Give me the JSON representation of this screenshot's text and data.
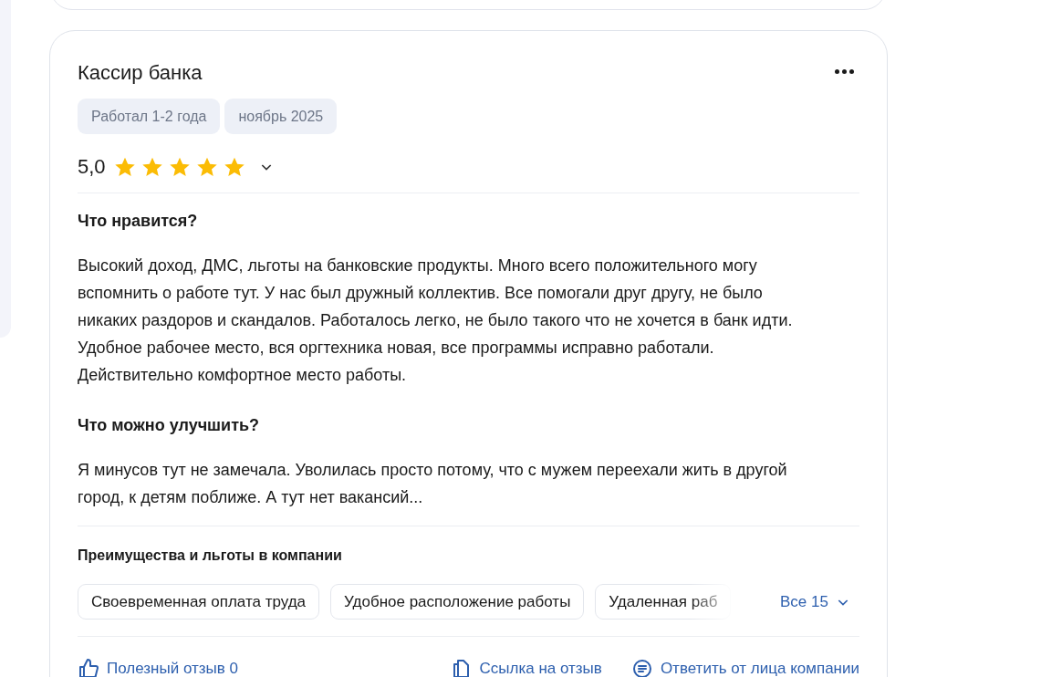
{
  "review": {
    "title": "Кассир банка",
    "tags": [
      "Работал 1-2 года",
      "ноябрь 2025"
    ],
    "rating": "5,0",
    "stars": 5,
    "sections": [
      {
        "heading": "Что нравится?",
        "text": "Высокий доход, ДМС, льготы на банковские продукты. Много всего положительного могу вспомнить о работе тут. У нас был дружный коллектив. Все помогали друг другу, не было никаких раздоров и скандалов. Работалось легко, не было такого что не хочется в банк идти. Удобное рабочее место, вся оргтехника новая, все программы исправно работали. Действительно комфортное место работы."
      },
      {
        "heading": "Что можно улучшить?",
        "text": "Я минусов тут не замечала. Уволилась просто потому, что с мужем переехали жить в другой город, к детям поближе. А тут нет вакансий..."
      }
    ],
    "benefits": {
      "heading": "Преимущества и льготы в компании",
      "items": [
        "Своевременная оплата труда",
        "Удобное расположение работы",
        "Удаленная раб"
      ],
      "more": "Все 15"
    },
    "actions": [
      {
        "kind": "like",
        "label": "Полезный отзыв 0"
      },
      {
        "kind": "link",
        "label": "Ссылка на отзыв"
      },
      {
        "kind": "reply",
        "label": "Ответить от лица компании"
      }
    ]
  }
}
